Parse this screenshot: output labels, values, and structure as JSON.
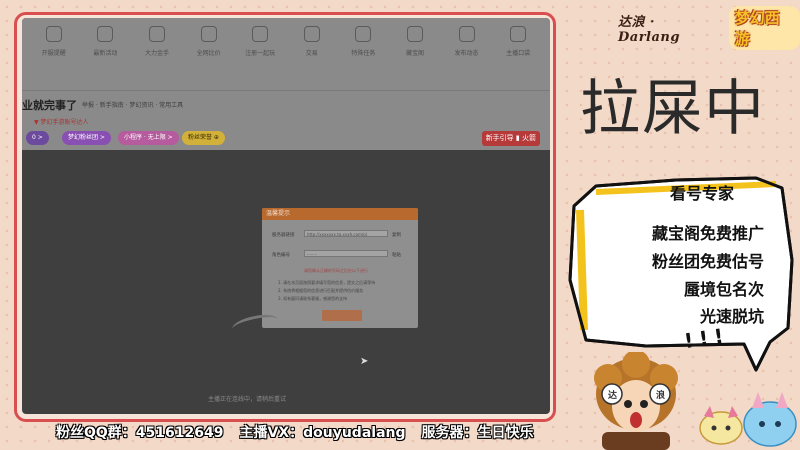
{
  "brand": {
    "streamer": "达浪 · Darlang",
    "logo": "梦幻西游"
  },
  "web": {
    "nav": [
      {
        "icon": "alarm-clock-icon",
        "label": "开服提醒"
      },
      {
        "icon": "calendar-icon",
        "label": "最新活动"
      },
      {
        "icon": "fire-icon",
        "label": "大力金手"
      },
      {
        "icon": "shield-icon",
        "label": "全网比价"
      },
      {
        "icon": "clipboard-icon",
        "label": "注册一起玩"
      },
      {
        "icon": "users-icon",
        "label": "交易"
      },
      {
        "icon": "gauge-icon",
        "label": "特殊任务"
      },
      {
        "icon": "coins-icon",
        "label": "藏宝阁"
      },
      {
        "icon": "edit-icon",
        "label": "发布动态"
      },
      {
        "icon": "folder-icon",
        "label": "主播口袋"
      }
    ],
    "heading": "业就完事了",
    "meta": "举报  · 新手指南 · 梦幻资讯 · 常用工具",
    "sub": "▼ 梦幻手游账号达人",
    "tags": [
      "0 >",
      "梦幻粉丝团 >",
      "小程序 · 无上限 >",
      "粉丝荣誉 ⊕"
    ],
    "newbie_button": "新手引导 ▮ 火箭"
  },
  "dialog": {
    "title": "温馨提示",
    "rows": [
      {
        "label": "服务器链接",
        "value": "http://xxxxxxx.tg.xyxh.com/pl",
        "side": "复制"
      },
      {
        "label": "角色编号",
        "value": "········",
        "side": "粘贴"
      }
    ],
    "warning": "请您确认正确的号码之后在以下进行",
    "notes": [
      "1. 请在本页面按照要求填写您的信息，提交之后请等待",
      "2. 系统将根据您的信息进行匹配并提供估价服务",
      "3. 如有疑问请联系客服，感谢您的支持"
    ]
  },
  "screen_status": "主播正在连线中，请稍后重试",
  "status": {
    "big": "拉屎中"
  },
  "promo": {
    "title": "看号专家",
    "lines": [
      "藏宝阁免费推广",
      "粉丝团免费估号",
      "蜃境包名次",
      "光速脱坑"
    ],
    "exclaim": "!!!"
  },
  "mascot": {
    "badge_left": "达",
    "badge_right": "浪"
  },
  "bottom": {
    "qq_group": "粉丝QQ群：451612649",
    "wechat": "主播VX：douyudalang",
    "server": "服务器：生日快乐"
  },
  "colors": {
    "frame": "#d94f4f",
    "background": "#f3d9c8",
    "dialog_header": "#b8692e"
  }
}
